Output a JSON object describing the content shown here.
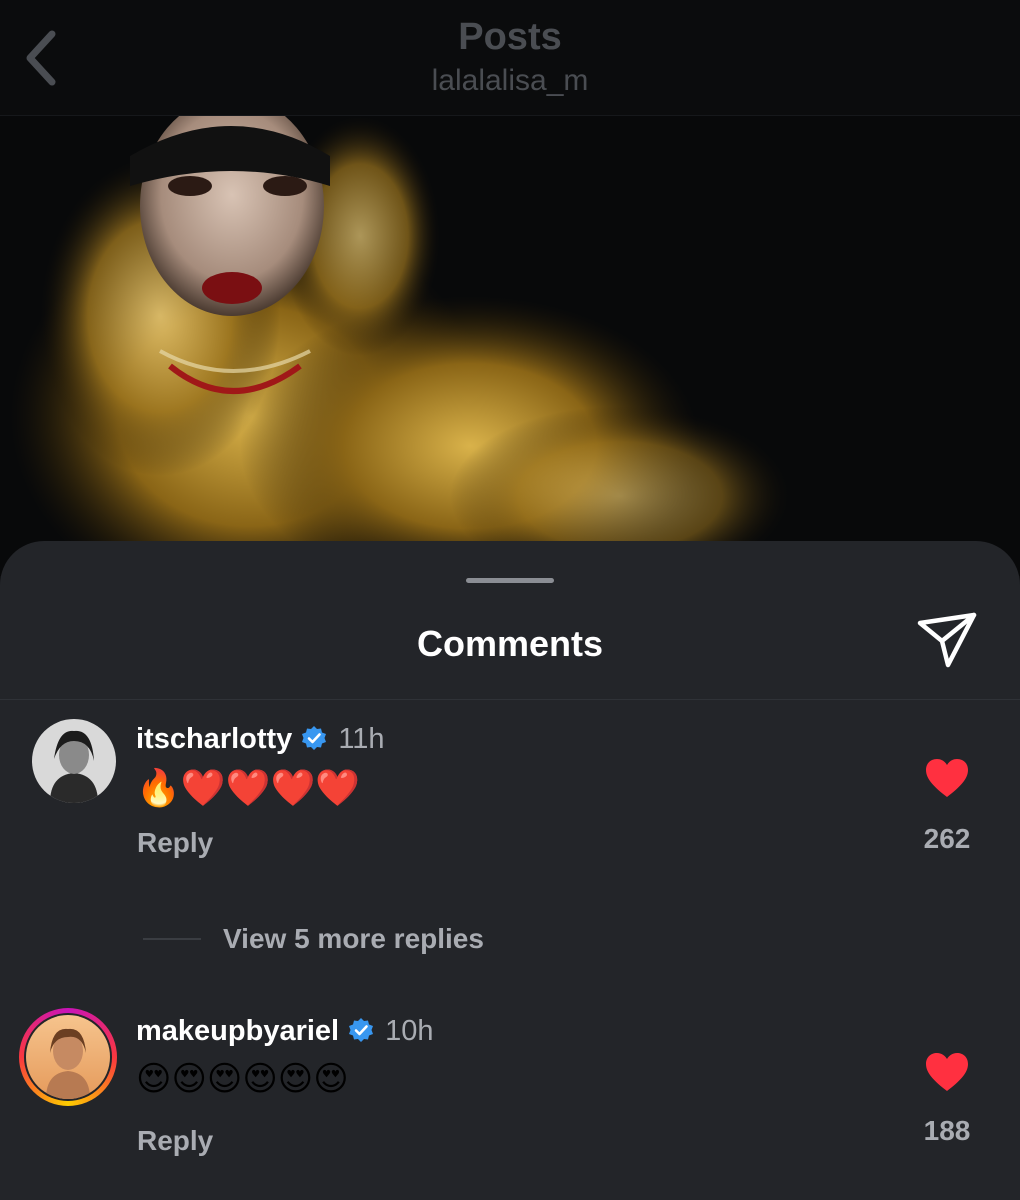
{
  "header": {
    "title": "Posts",
    "subtitle": "lalalalisa_m"
  },
  "sheet": {
    "title": "Comments"
  },
  "comments": [
    {
      "username": "itscharlotty",
      "verified": true,
      "time": "11h",
      "text": "🔥❤️❤️❤️❤️",
      "reply_label": "Reply",
      "likes": "262",
      "view_more": "View 5 more replies"
    },
    {
      "username": "makeupbyariel",
      "verified": true,
      "time": "10h",
      "text": "😍😍😍😍😍😍",
      "reply_label": "Reply",
      "likes": "188"
    }
  ],
  "colors": {
    "sheet_bg": "#232529",
    "like_red": "#ff3040",
    "verified_blue": "#3897f0",
    "secondary_text": "#a9acb2"
  }
}
